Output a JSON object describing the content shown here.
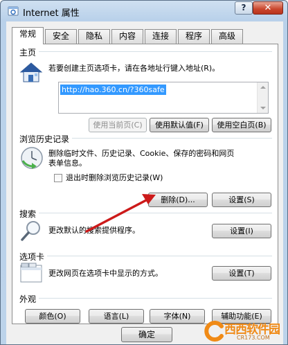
{
  "window": {
    "title": "Internet 属性",
    "help_label": "?",
    "close_label": "✕"
  },
  "tabs": [
    {
      "label": "常规",
      "active": true
    },
    {
      "label": "安全"
    },
    {
      "label": "隐私"
    },
    {
      "label": "内容"
    },
    {
      "label": "连接"
    },
    {
      "label": "程序"
    },
    {
      "label": "高级"
    }
  ],
  "homepage": {
    "section_label": "主页",
    "description": "若要创建主页选项卡，请在各地址行键入地址(R)。",
    "address_value": "http://hao.360.cn/?360safe",
    "use_current_label": "使用当前页(C)",
    "use_default_label": "使用默认值(F)",
    "use_blank_label": "使用空白页(B)"
  },
  "history": {
    "section_label": "浏览历史记录",
    "description_line1": "删除临时文件、历史记录、Cookie、保存的密码和网页",
    "description_line2": "表单信息。",
    "checkbox_label": "退出时删除浏览历史记录(W)",
    "delete_label": "删除(D)...",
    "settings_label": "设置(S)"
  },
  "search": {
    "section_label": "搜索",
    "description": "更改默认的搜索提供程序。",
    "settings_label": "设置(I)"
  },
  "tabbed": {
    "section_label": "选项卡",
    "description": "更改网页在选项卡中显示的方式。",
    "settings_label": "设置(T)"
  },
  "appearance": {
    "section_label": "外观",
    "colors_label": "颜色(O)",
    "languages_label": "语言(L)",
    "fonts_label": "字体(N)",
    "accessibility_label": "辅助功能(E)"
  },
  "footer": {
    "ok_label": "确定"
  },
  "watermark": {
    "brand": "西西软件园",
    "url": "CR173.COM"
  },
  "colors": {
    "selection": "#3399ff",
    "arrow": "#cc1a1a",
    "watermark": "#f08a16"
  }
}
